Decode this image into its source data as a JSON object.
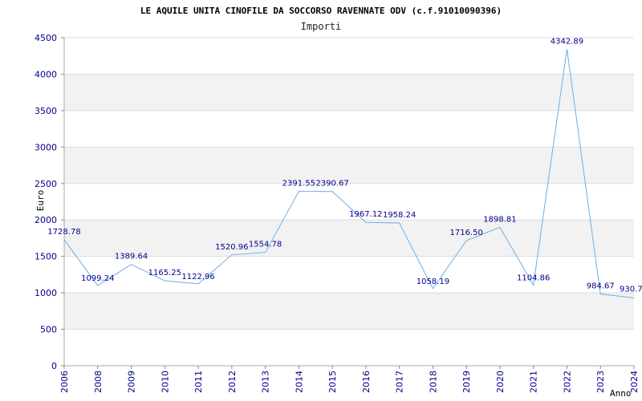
{
  "chart_data": {
    "type": "line",
    "title": "LE AQUILE UNITA CINOFILE DA SOCCORSO RAVENNATE ODV (c.f.91010090396)",
    "subtitle": "Importi",
    "xlabel": "Anno",
    "ylabel": "Euro",
    "ylim": [
      0,
      4500
    ],
    "yticks": [
      0,
      500,
      1000,
      1500,
      2000,
      2500,
      3000,
      3500,
      4000,
      4500
    ],
    "categories": [
      "2006",
      "2008",
      "2009",
      "2010",
      "2011",
      "2012",
      "2013",
      "2014",
      "2015",
      "2016",
      "2017",
      "2018",
      "2019",
      "2020",
      "2021",
      "2022",
      "2023",
      "2024"
    ],
    "series": [
      {
        "values": [
          1728.78,
          1099.24,
          1389.64,
          1165.25,
          1122.96,
          1520.96,
          1554.78,
          2391.55,
          2390.67,
          1967.12,
          1958.24,
          1058.19,
          1716.5,
          1898.81,
          1104.86,
          4342.89,
          984.67,
          930.7
        ],
        "labels": [
          "1728.78",
          "1099.24",
          "1389.64",
          "1165.25",
          "1122.96",
          "1520.96",
          "1554.78",
          "2391.55",
          "2390.67",
          "1967.12",
          "1958.24",
          "1058.19",
          "1716.50",
          "1898.81",
          "1104.86",
          "4342.89",
          "984.67",
          "930.7"
        ]
      }
    ],
    "line_color": "#6aaee8",
    "band_color": "#f2f2f2",
    "tick_color": "#00008b",
    "grid": true
  }
}
